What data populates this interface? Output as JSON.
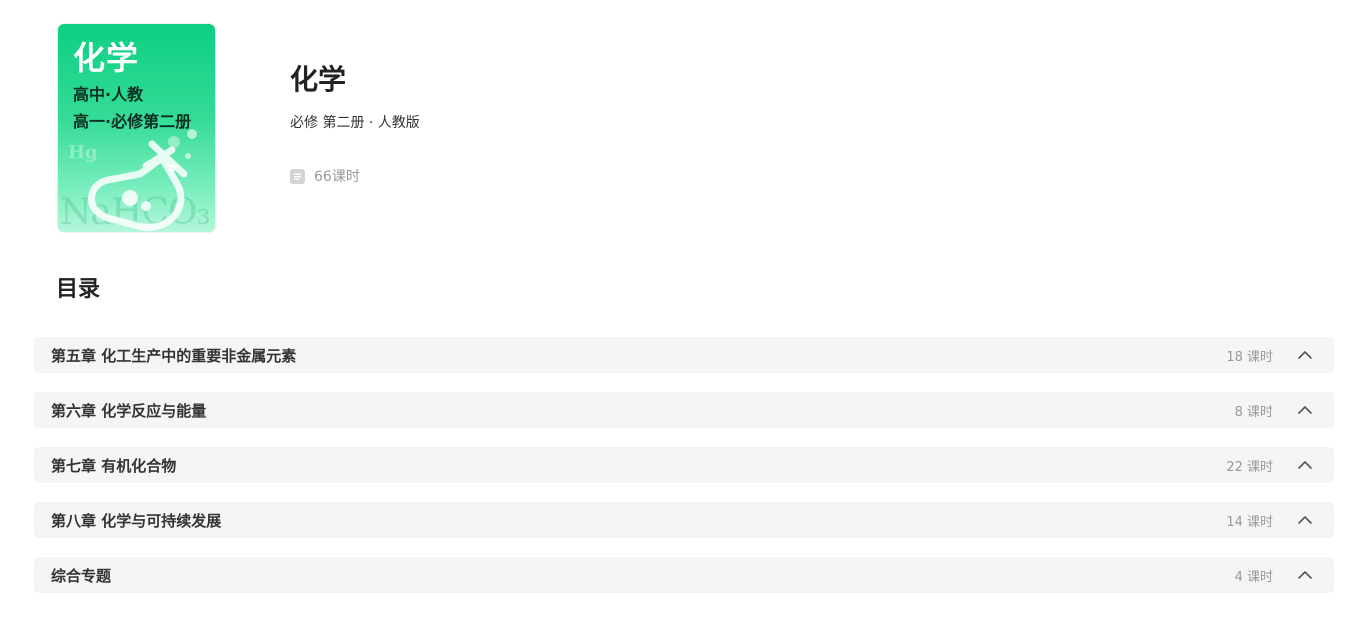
{
  "cover": {
    "title": "化学",
    "line1": "高中·人教",
    "line2": "高一·必修第二册",
    "deco_hg": "Hg",
    "deco_formula": "NaHCO₃"
  },
  "book": {
    "title": "化学",
    "subtitle": "必修 第二册 · 人教版",
    "lesson_count": "66课时",
    "lesson_icon": "document-icon"
  },
  "toc": {
    "heading": "目录",
    "chapters": [
      {
        "title": "第五章 化工生产中的重要非金属元素",
        "count": "18 课时",
        "icon": "chevron-up-icon"
      },
      {
        "title": "第六章 化学反应与能量",
        "count": "8 课时",
        "icon": "chevron-up-icon"
      },
      {
        "title": "第七章 有机化合物",
        "count": "22 课时",
        "icon": "chevron-up-icon"
      },
      {
        "title": "第八章 化学与可持续发展",
        "count": "14 课时",
        "icon": "chevron-up-icon"
      },
      {
        "title": "综合专题",
        "count": "4 课时",
        "icon": "chevron-up-icon"
      }
    ]
  },
  "colors": {
    "cover_green": "#0ccf82",
    "row_background": "#f5f5f5",
    "muted_text": "#999999"
  }
}
